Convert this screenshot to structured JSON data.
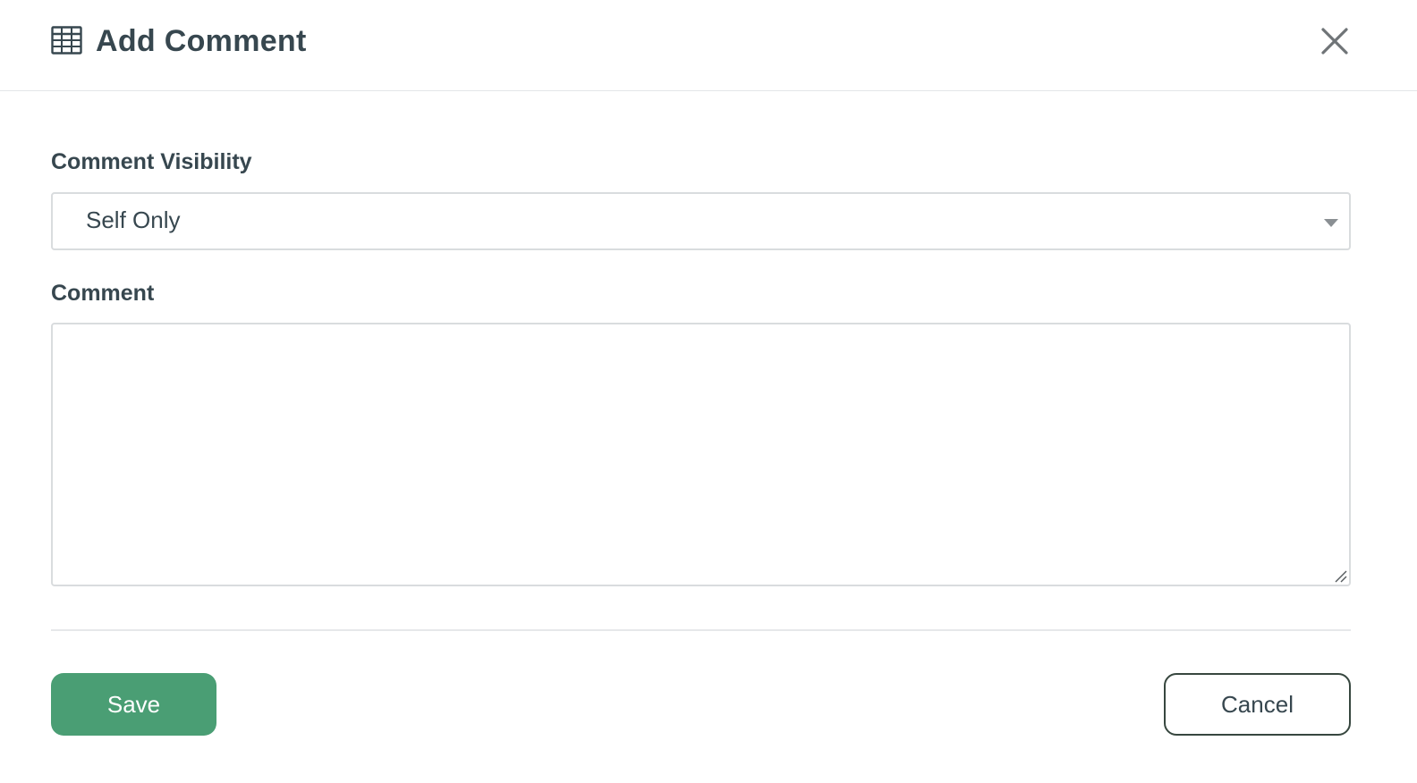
{
  "dialog": {
    "title": "Add Comment",
    "title_icon": "grid-table-icon",
    "close_icon": "close-icon"
  },
  "form": {
    "visibility_label": "Comment Visibility",
    "visibility_selected": "Self Only",
    "comment_label": "Comment",
    "comment_value": "",
    "comment_placeholder": ""
  },
  "footer": {
    "save_label": "Save",
    "cancel_label": "Cancel"
  },
  "colors": {
    "primary_green": "#4a9e74",
    "text_dark": "#37474f",
    "border_light": "#d9dcde"
  }
}
